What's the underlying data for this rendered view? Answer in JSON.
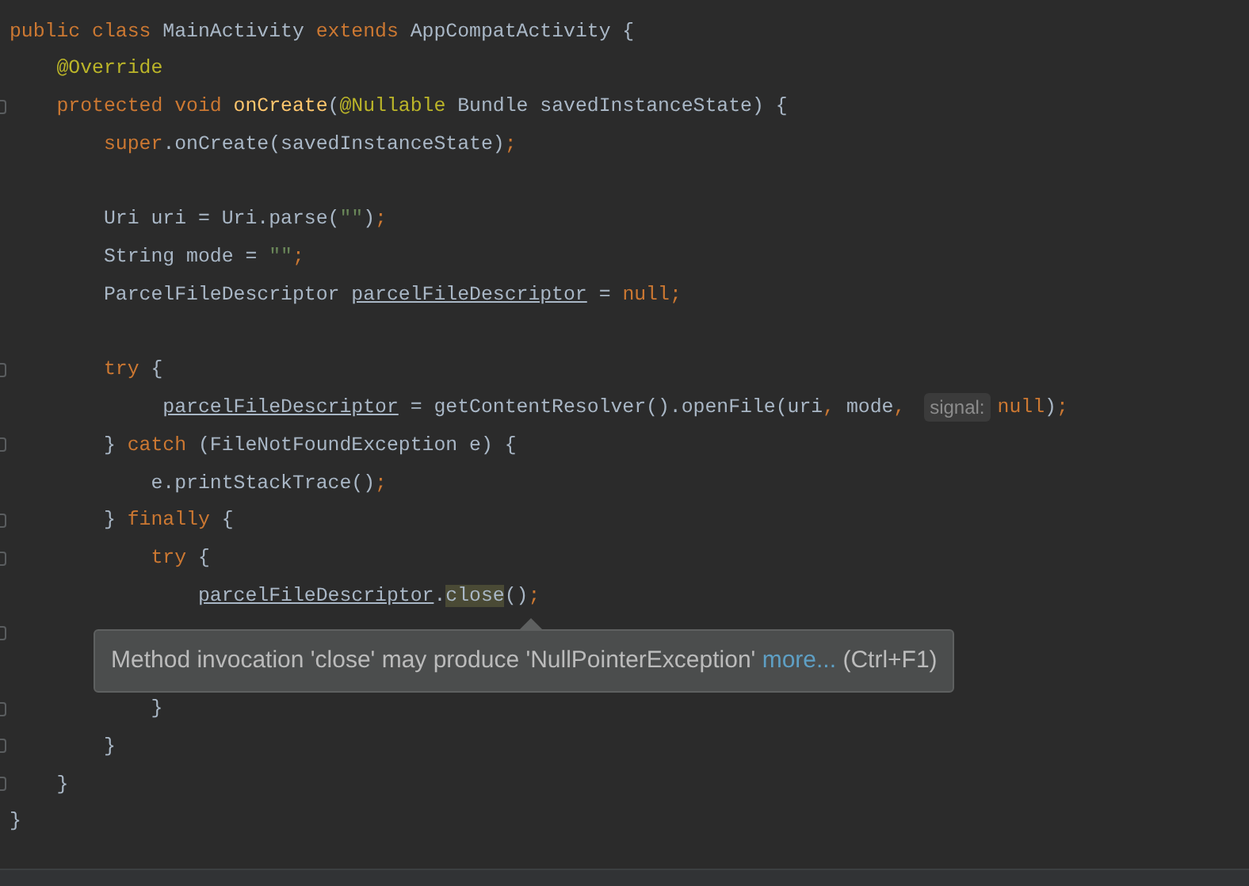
{
  "editor": {
    "lines": [
      {
        "fold": false,
        "tokens": [
          {
            "kind": "kw",
            "text": "public class "
          },
          {
            "kind": "plain",
            "text": "MainActivity "
          },
          {
            "kind": "kw",
            "text": "extends "
          },
          {
            "kind": "plain",
            "text": "AppCompatActivity {"
          }
        ]
      },
      {
        "fold": false,
        "tokens": [
          {
            "kind": "ann",
            "text": "    @Override"
          }
        ]
      },
      {
        "fold": true,
        "tokens": [
          {
            "kind": "kw",
            "text": "    protected void "
          },
          {
            "kind": "fn",
            "text": "onCreate"
          },
          {
            "kind": "plain",
            "text": "("
          },
          {
            "kind": "ann",
            "text": "@Nullable "
          },
          {
            "kind": "plain",
            "text": "Bundle savedInstanceState) {"
          }
        ]
      },
      {
        "fold": false,
        "tokens": [
          {
            "kind": "kw",
            "text": "        super"
          },
          {
            "kind": "plain",
            "text": ".onCreate(savedInstanceState)"
          },
          {
            "kind": "punct",
            "text": ";"
          }
        ]
      },
      {
        "fold": false
      },
      {
        "fold": false,
        "tokens": [
          {
            "kind": "plain",
            "text": "        Uri uri = Uri.parse("
          },
          {
            "kind": "str",
            "text": "\"\""
          },
          {
            "kind": "plain",
            "text": ")"
          },
          {
            "kind": "punct",
            "text": ";"
          }
        ]
      },
      {
        "fold": false,
        "tokens": [
          {
            "kind": "plain",
            "text": "        String mode = "
          },
          {
            "kind": "str",
            "text": "\"\""
          },
          {
            "kind": "punct",
            "text": ";"
          }
        ]
      },
      {
        "fold": false,
        "tokens": [
          {
            "kind": "plain",
            "text": "        ParcelFileDescriptor "
          },
          {
            "kind": "field",
            "text": "parcelFileDescriptor"
          },
          {
            "kind": "plain",
            "text": " = "
          },
          {
            "kind": "kw",
            "text": "null"
          },
          {
            "kind": "punct",
            "text": ";"
          }
        ]
      },
      {
        "fold": false
      },
      {
        "fold": true,
        "tokens": [
          {
            "kind": "kw",
            "text": "        try "
          },
          {
            "kind": "plain",
            "text": "{"
          }
        ]
      },
      {
        "fold": false,
        "tokens": [
          {
            "kind": "field",
            "text": "             parcelFileDescriptor"
          },
          {
            "kind": "plain",
            "text": " = getContentResolver().openFile(uri"
          },
          {
            "kind": "punct",
            "text": ", "
          },
          {
            "kind": "plain",
            "text": "mode"
          },
          {
            "kind": "punct",
            "text": ", "
          },
          {
            "kind": "hint",
            "text": "signal:"
          },
          {
            "kind": "kw",
            "text": "null"
          },
          {
            "kind": "plain",
            "text": ")"
          },
          {
            "kind": "punct",
            "text": ";"
          }
        ]
      },
      {
        "fold": true,
        "tokens": [
          {
            "kind": "plain",
            "text": "        } "
          },
          {
            "kind": "kw",
            "text": "catch "
          },
          {
            "kind": "plain",
            "text": "(FileNotFoundException e) {"
          }
        ]
      },
      {
        "fold": false,
        "tokens": [
          {
            "kind": "plain",
            "text": "            e.printStackTrace()"
          },
          {
            "kind": "punct",
            "text": ";"
          }
        ]
      },
      {
        "fold": true,
        "tokens": [
          {
            "kind": "plain",
            "text": "        } "
          },
          {
            "kind": "kw",
            "text": "finally "
          },
          {
            "kind": "plain",
            "text": "{"
          }
        ]
      },
      {
        "fold": true,
        "tokens": [
          {
            "kind": "kw",
            "text": "            try "
          },
          {
            "kind": "plain",
            "text": "{"
          }
        ]
      },
      {
        "fold": false,
        "tokens": [
          {
            "kind": "field",
            "text": "                parcelFileDescriptor"
          },
          {
            "kind": "plain",
            "text": "."
          },
          {
            "kind": "hl",
            "text": "close"
          },
          {
            "kind": "plain",
            "text": "()"
          },
          {
            "kind": "punct",
            "text": ";"
          }
        ]
      },
      {
        "fold": true
      },
      {
        "fold": false
      },
      {
        "fold": true,
        "tokens": [
          {
            "kind": "plain",
            "text": "            }"
          }
        ]
      },
      {
        "fold": true,
        "tokens": [
          {
            "kind": "plain",
            "text": "        }"
          }
        ]
      },
      {
        "fold": true,
        "tokens": [
          {
            "kind": "plain",
            "text": "    }"
          }
        ]
      },
      {
        "fold": false,
        "tokens": [
          {
            "kind": "plain",
            "text": "}"
          }
        ]
      }
    ]
  },
  "tooltip": {
    "message": "Method invocation 'close' may produce 'NullPointerException'",
    "link": "more...",
    "shortcut": "(Ctrl+F1)"
  }
}
